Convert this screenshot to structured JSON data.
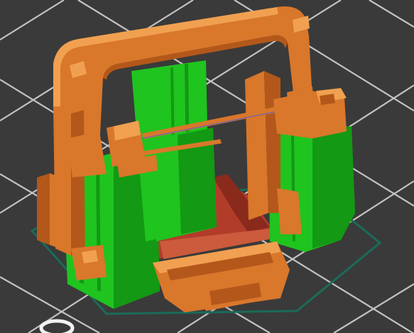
{
  "viewport": {
    "background_color": "#3a3a3a",
    "grid_line_color": "#dcdcdc",
    "brim_outline_color": "#1b6b5a",
    "colors": {
      "perimeter": "#d9772b",
      "perimeter_dark": "#b3581a",
      "perimeter_light": "#f0a050",
      "support": "#1fc41f",
      "support_dark": "#139913",
      "infill_floor": "#b23c2a",
      "infill_floor_light": "#cc5a3c",
      "bridge_inner": "#6c4a7a",
      "travel_line": "#5560d0"
    },
    "icons": [
      "bed-origin-icon"
    ]
  }
}
